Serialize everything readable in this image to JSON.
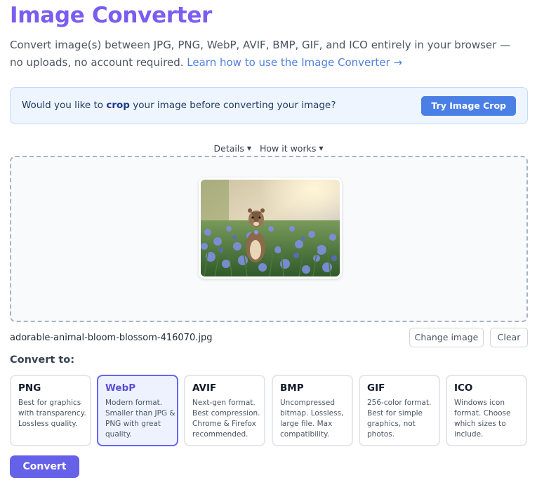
{
  "header": {
    "title": "Image Converter",
    "description": "Convert image(s) between JPG, PNG, WebP, AVIF, BMP, GIF, and ICO entirely in your browser — no uploads, no account required.",
    "learn_link": "Learn how to use the Image Converter →"
  },
  "crop_banner": {
    "text_before": "Would you like to ",
    "text_bold": "crop",
    "text_after": " your image before converting your image?",
    "button_label": "Try Image Crop"
  },
  "toggles": {
    "details": "Details",
    "how_it_works": "How it works"
  },
  "file": {
    "name": "adorable-animal-bloom-blossom-416070.jpg",
    "change_label": "Change image",
    "clear_label": "Clear"
  },
  "convert_to_label": "Convert to:",
  "formats": [
    {
      "name": "PNG",
      "desc": "Best for graphics with transparency. Lossless quality."
    },
    {
      "name": "WebP",
      "desc": "Modern format. Smaller than JPG & PNG with great quality."
    },
    {
      "name": "AVIF",
      "desc": "Next-gen format. Best compression. Chrome & Firefox recommended."
    },
    {
      "name": "BMP",
      "desc": "Uncompressed bitmap. Lossless, large file. Max compatibility."
    },
    {
      "name": "GIF",
      "desc": "256-color format. Best for simple graphics, not photos."
    },
    {
      "name": "ICO",
      "desc": "Windows icon format. Choose which sizes to include."
    }
  ],
  "selected_format": "WebP",
  "convert_button": "Convert",
  "colors": {
    "title": "#7c5cf0",
    "link": "#4f7fe0",
    "banner_button": "#4a7fe6",
    "selected_border": "#6366f1",
    "convert_button": "#6561e8"
  }
}
